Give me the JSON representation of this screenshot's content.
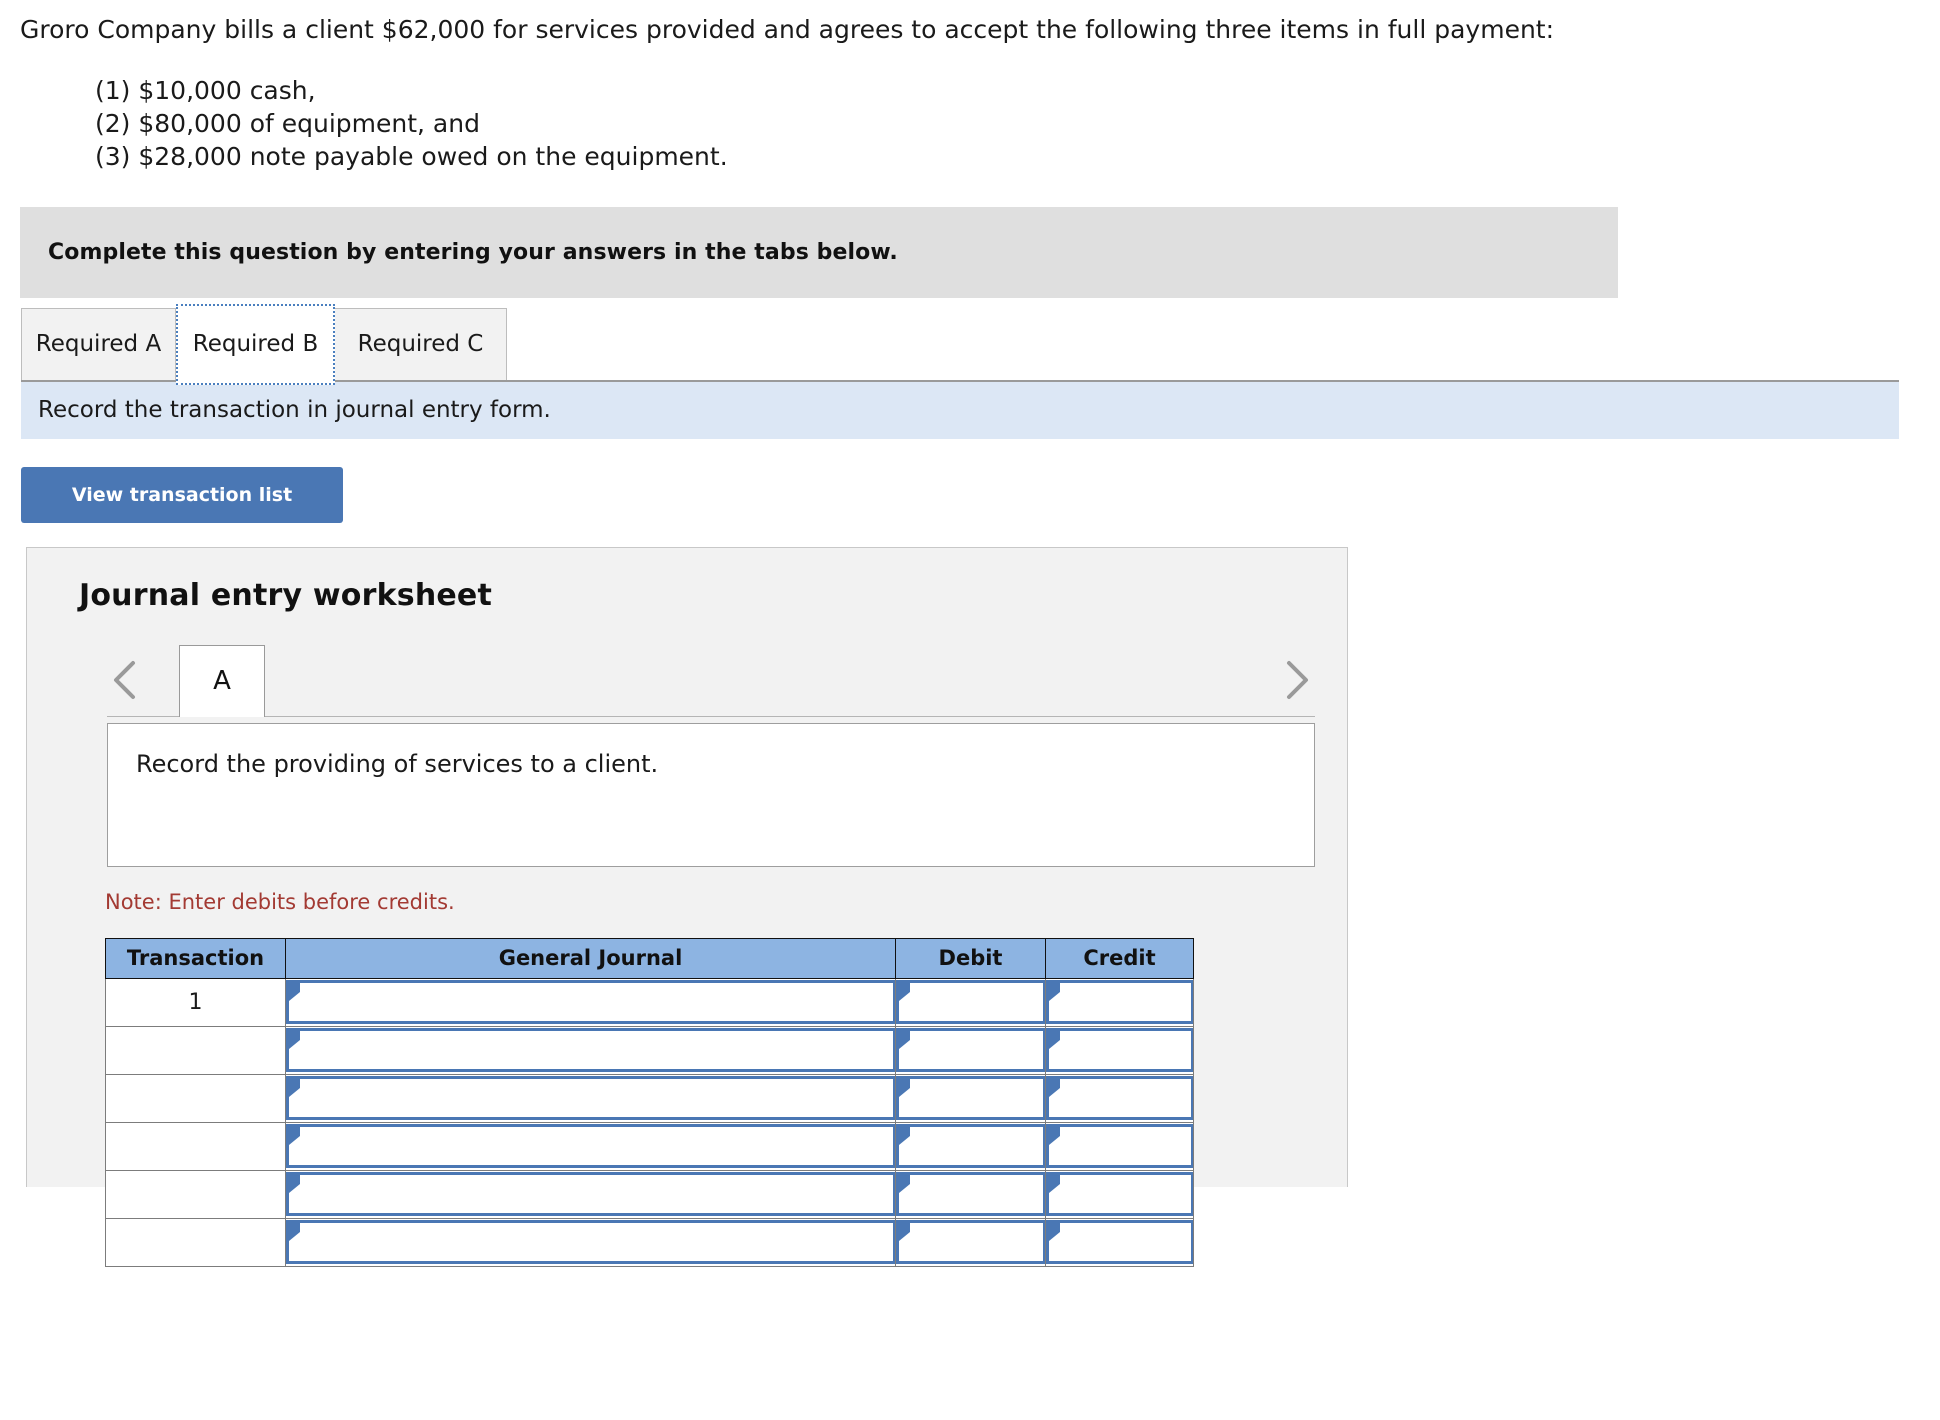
{
  "problem": {
    "lead": "Groro Company bills a client $62,000 for services provided and agrees to accept the following three items in full payment:",
    "items": [
      "(1) $10,000 cash,",
      "(2) $80,000 of equipment, and",
      "(3) $28,000 note payable owed on the equipment."
    ]
  },
  "complete_bar": {
    "text": "Complete this question by entering your answers in the tabs below."
  },
  "required_tabs": [
    {
      "label": "Required A",
      "active": false
    },
    {
      "label": "Required B",
      "active": true
    },
    {
      "label": "Required C",
      "active": false
    }
  ],
  "instruction": {
    "text": "Record the transaction in journal entry form."
  },
  "toolbar": {
    "view_transaction_list_label": "View transaction list"
  },
  "worksheet": {
    "title": "Journal entry worksheet",
    "prev_icon": "chevron-left-icon",
    "next_icon": "chevron-right-icon",
    "entry_tabs": [
      {
        "label": "A",
        "active": true
      }
    ],
    "description": "Record the providing of services to a client.",
    "note": "Note: Enter debits before credits.",
    "table": {
      "columns": [
        "Transaction",
        "General Journal",
        "Debit",
        "Credit"
      ],
      "rows": [
        {
          "transaction": "1",
          "general_journal": "",
          "debit": "",
          "credit": ""
        },
        {
          "transaction": "",
          "general_journal": "",
          "debit": "",
          "credit": ""
        },
        {
          "transaction": "",
          "general_journal": "",
          "debit": "",
          "credit": ""
        },
        {
          "transaction": "",
          "general_journal": "",
          "debit": "",
          "credit": ""
        },
        {
          "transaction": "",
          "general_journal": "",
          "debit": "",
          "credit": ""
        },
        {
          "transaction": "",
          "general_journal": "",
          "debit": "",
          "credit": ""
        }
      ]
    }
  },
  "colors": {
    "header_blue": "#8db4e2",
    "button_blue": "#4a77b4",
    "instruction_blue": "#dce7f5",
    "complete_gray": "#dfdfdf",
    "panel_gray": "#f2f2f2",
    "note_red": "#a33a33",
    "focus_blue": "#4a7fbf"
  }
}
